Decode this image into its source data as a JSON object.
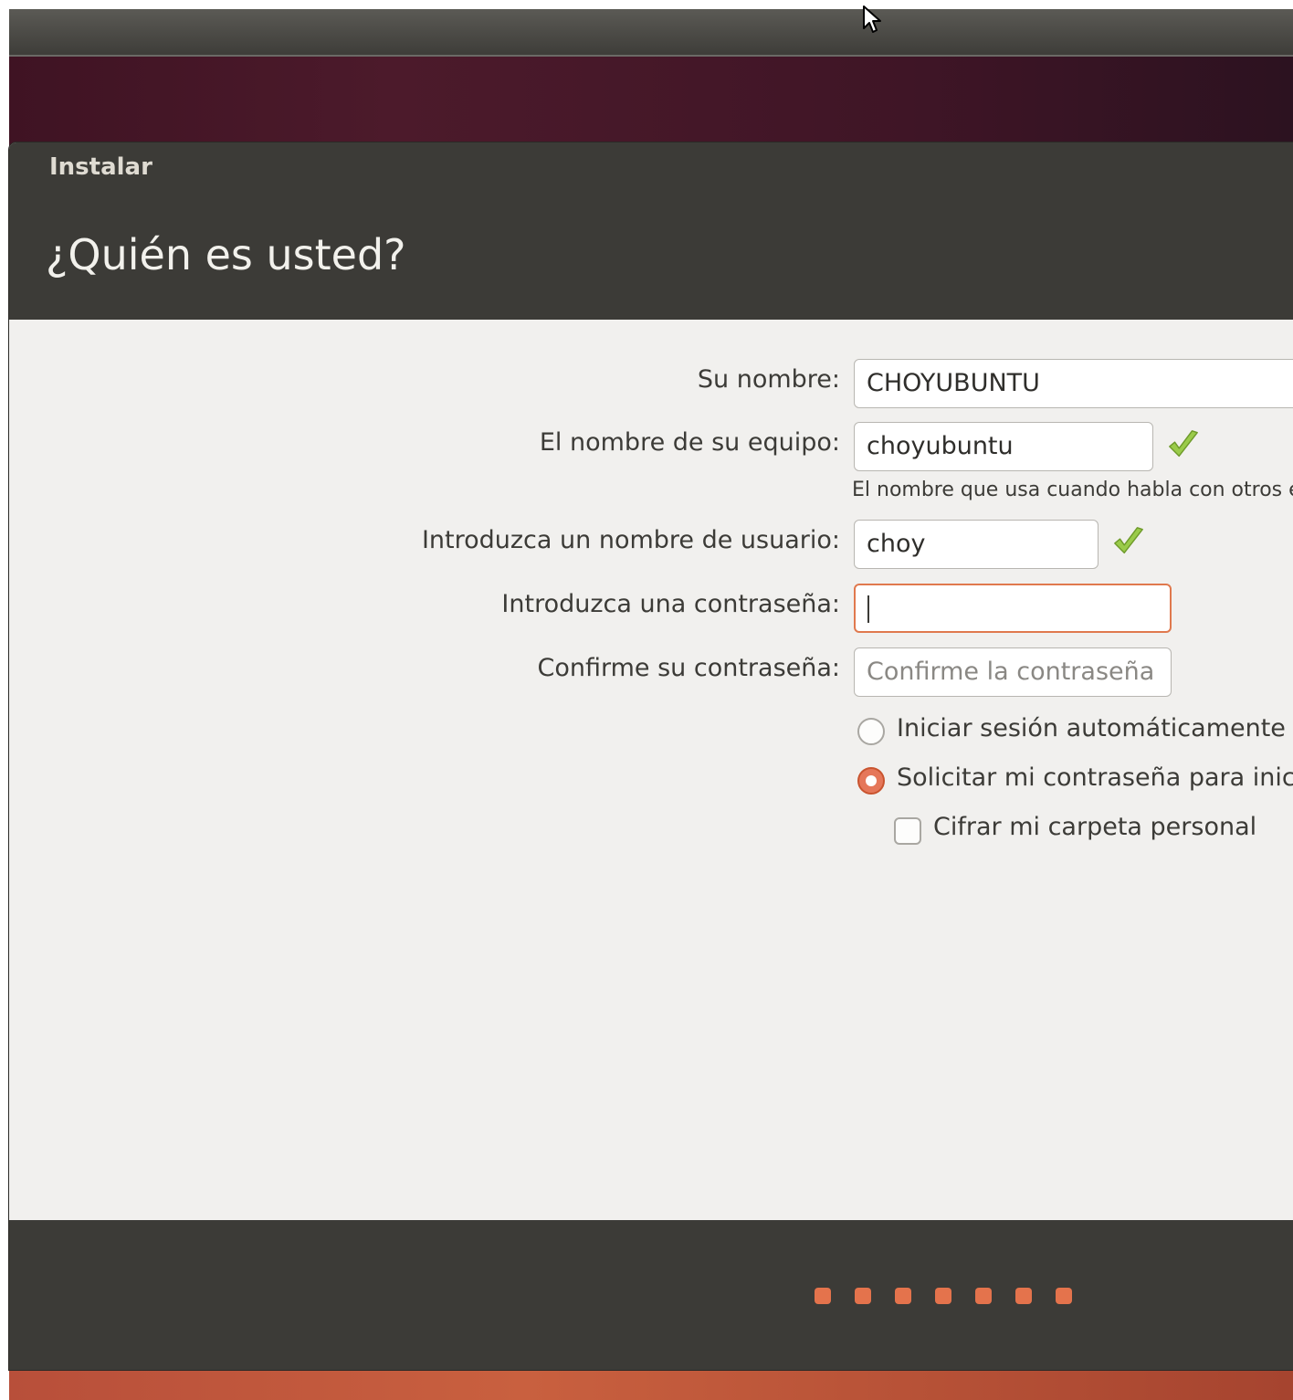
{
  "window": {
    "title": "Instalar"
  },
  "header": {
    "title": "¿Quién es usted?"
  },
  "form": {
    "name": {
      "label": "Su nombre:",
      "value": "CHOYUBUNTU"
    },
    "computer_name": {
      "label": "El nombre de su equipo:",
      "value": "choyubuntu",
      "hint": "El nombre que usa cuando habla con otros e"
    },
    "username": {
      "label": "Introduzca un nombre de usuario:",
      "value": "choy"
    },
    "password": {
      "label": "Introduzca una contraseña:",
      "value": ""
    },
    "confirm_password": {
      "label": "Confirme su contraseña:",
      "placeholder": "Confirme la contraseña"
    },
    "options": {
      "auto_login": {
        "label": "Iniciar sesión automáticamente",
        "selected": false
      },
      "require_password": {
        "label": "Solicitar mi contraseña para inici",
        "selected": true
      },
      "encrypt_home": {
        "label": "Cifrar mi carpeta personal",
        "checked": false
      }
    }
  },
  "progress": {
    "total_steps": 7
  },
  "icons": {
    "valid": "check-icon",
    "cursor": "mouse-pointer-icon"
  },
  "colors": {
    "accent": "#e4734c",
    "dark_panel": "#3c3b37",
    "content_bg": "#f1f0ee",
    "check_green": "#8cc63f"
  }
}
